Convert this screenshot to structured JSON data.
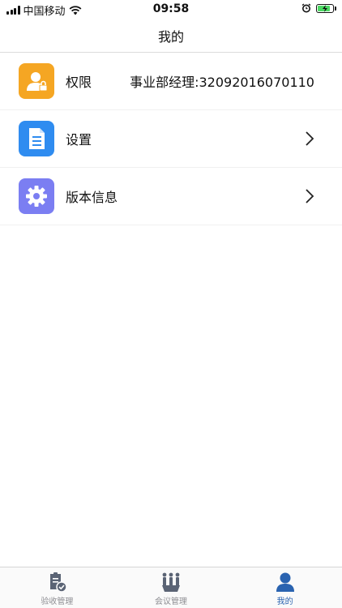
{
  "status_bar": {
    "carrier": "中国移动",
    "time": "09:58",
    "battery_level": 0.9
  },
  "nav": {
    "title": "我的"
  },
  "rows": [
    {
      "label": "权限",
      "value": "事业部经理:32092016070110",
      "icon": "user-lock-icon",
      "color": "#f5a623"
    },
    {
      "label": "设置",
      "icon": "document-icon",
      "color": "#2f8cf0"
    },
    {
      "label": "版本信息",
      "icon": "gear-icon",
      "color": "#7b7ef2"
    }
  ],
  "tabs": [
    {
      "label": "验收管理",
      "icon": "clipboard-check-icon",
      "active": false
    },
    {
      "label": "会议管理",
      "icon": "meeting-people-icon",
      "active": false
    },
    {
      "label": "我的",
      "icon": "person-icon",
      "active": true
    }
  ],
  "colors": {
    "active": "#2a63b0",
    "inactive": "#5b6475"
  }
}
